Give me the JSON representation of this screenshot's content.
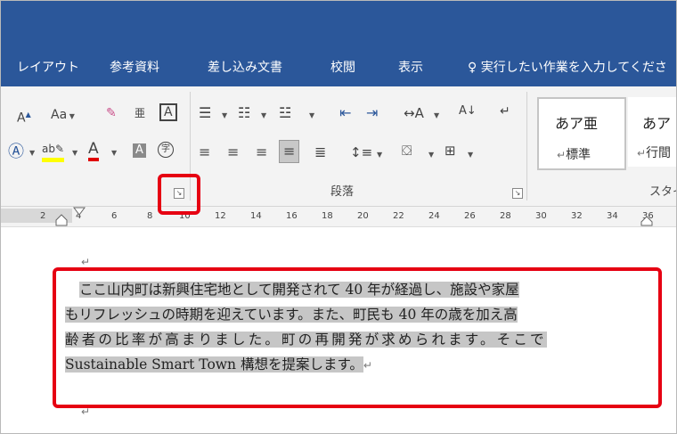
{
  "tabs": [
    "レイアウト",
    "参考資料",
    "差し込み文書",
    "校閲",
    "表示"
  ],
  "tell_me": "実行したい作業を入力してくださ",
  "font_group": {
    "change_case": "Aa",
    "clear_format": "A",
    "char_border": "A",
    "enclose": "字",
    "font_color": "A",
    "shade": "A",
    "phonetic": "亜"
  },
  "paragraph_group_label": "段落",
  "styles_group_label": "スタイ",
  "styles": [
    {
      "preview": "あア亜",
      "name": "標準"
    },
    {
      "preview": "あア",
      "name": "行間"
    }
  ],
  "ruler_numbers": [
    "2",
    "4",
    "6",
    "8",
    "10",
    "12",
    "14",
    "16",
    "18",
    "20",
    "22",
    "24",
    "26",
    "28",
    "30",
    "32",
    "34",
    "36"
  ],
  "return_mark": "↵",
  "body_lines": [
    "ここ山内町は新興住宅地として開発されて 40 年が経過し、施設や家屋",
    "もリフレッシュの時期を迎えています。また、町民も 40 年の歳を加え高",
    "齢者の比率が高まりました。町の再開発が求められます。そこで",
    "Sustainable Smart Town 構想を提案します。"
  ],
  "colors": {
    "titlebar": "#2b579a",
    "highlight": "#c6c6c6",
    "annotation": "#e60012"
  }
}
